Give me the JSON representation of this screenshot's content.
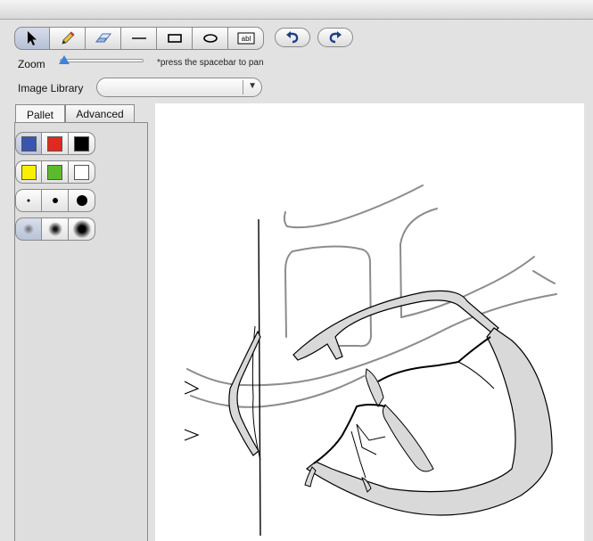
{
  "toolbar": {
    "tools": [
      "arrow-icon",
      "pencil-icon",
      "eraser-icon",
      "line-icon",
      "rectangle-icon",
      "ellipse-icon",
      "text-field-icon"
    ],
    "undo_icon": "undo-icon",
    "redo_icon": "redo-icon",
    "text_tool_glyph": "abl"
  },
  "zoom": {
    "label": "Zoom",
    "level": 0.0,
    "hint": "*press the spacebar to pan"
  },
  "library": {
    "label": "Image Library",
    "value": ""
  },
  "tabs": [
    {
      "label": "Pallet",
      "active": true
    },
    {
      "label": "Advanced",
      "active": false
    }
  ],
  "palette": {
    "colors": [
      "#3a55b0",
      "#e02a20",
      "#000000",
      "#f8f000",
      "#5cbb2c",
      "#ffffff"
    ],
    "brush_sizes": [
      "small",
      "medium",
      "large"
    ],
    "soft_brushes": [
      "soft-small",
      "soft-medium",
      "soft-large"
    ]
  },
  "colors": {
    "selection": "#b9c3d8",
    "fill": "#d9d9d9",
    "stroke": "#8c8c8c",
    "ink": "#000000"
  }
}
